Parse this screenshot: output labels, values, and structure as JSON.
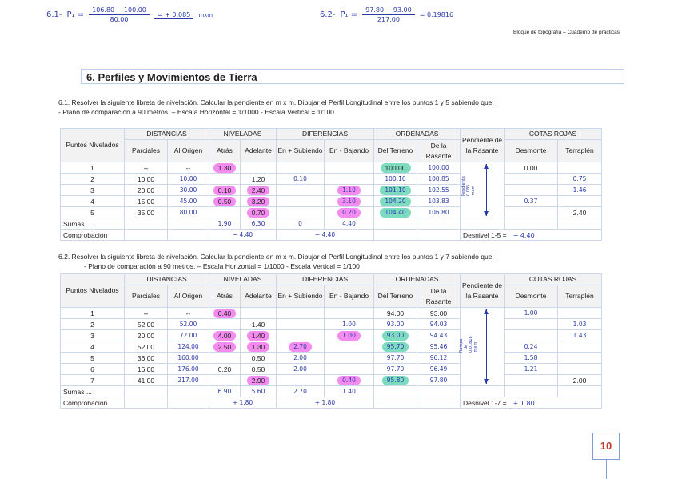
{
  "formulas": [
    {
      "label": "6.1-",
      "var": "P₁ =",
      "num": "106.80 − 100.00",
      "den": "80.00",
      "result": "= + 0.085",
      "unit": "mxm"
    },
    {
      "label": "6.2-",
      "var": "P₁ =",
      "num": "97.80 − 93.00",
      "den": "217.00",
      "result": "= 0.19816",
      "unit": ""
    }
  ],
  "header_note": "Bloque de topografía – Cuaderno de prácticas",
  "section_title": "6. Perfiles y Movimientos de Tierra",
  "headers": {
    "puntos": "Puntos Nivelados",
    "distancias": "DISTANCIAS",
    "niveladas": "NIVELADAS",
    "diferencias": "DIFERENCIAS",
    "ordenadas": "ORDENADAS",
    "pendiente": "Pendiente de la Rasante",
    "cotas": "COTAS  ROJAS",
    "sub": [
      "Parciales",
      "Al Origen",
      "Atrás",
      "Adelante",
      "En + Subiendo",
      "En - Bajando",
      "Del Terreno",
      "De la Rasante",
      "Desmonte",
      "Terraplén"
    ]
  },
  "exercises": [
    {
      "statement1": "6.1. Resolver la siguiente libreta de nivelación. Calcular la pendiente en m x m. Dibujar el Perfil Longitudinal entre los puntos 1 y 5 sabiendo que:",
      "statement2": "- Plano de comparación a 90 metros.   – Escala Horizontal = 1/1000       - Escala Vertical = 1/100",
      "pendiente_note": "Pendiente 0.085 mxm",
      "rows": [
        {
          "cells": [
            {
              "v": "1"
            },
            {
              "v": "--"
            },
            {
              "v": "--"
            },
            {
              "v": "1.30",
              "hl": "pink"
            },
            {
              "v": ""
            },
            {
              "v": ""
            },
            {
              "v": ""
            },
            {
              "v": "100.00",
              "hl": "teal"
            },
            {
              "v": "100.00",
              "h": 1
            },
            {
              "v": "0.00"
            },
            {
              "v": ""
            }
          ]
        },
        {
          "cells": [
            {
              "v": "2"
            },
            {
              "v": "10.00"
            },
            {
              "v": "10.00",
              "h": 1
            },
            {
              "v": ""
            },
            {
              "v": "1.20"
            },
            {
              "v": "0.10",
              "h": 1
            },
            {
              "v": ""
            },
            {
              "v": "100.10",
              "h": 1
            },
            {
              "v": "100.85",
              "h": 1
            },
            {
              "v": ""
            },
            {
              "v": "0.75",
              "h": 1
            }
          ]
        },
        {
          "cells": [
            {
              "v": "3"
            },
            {
              "v": "20.00"
            },
            {
              "v": "30.00",
              "h": 1
            },
            {
              "v": "0.10",
              "hl": "pink"
            },
            {
              "v": "2.40",
              "hl": "pink"
            },
            {
              "v": ""
            },
            {
              "v": "1.10",
              "h": 1,
              "hl": "pink"
            },
            {
              "v": "101.10",
              "h": 1,
              "hl": "teal"
            },
            {
              "v": "102.55",
              "h": 1
            },
            {
              "v": ""
            },
            {
              "v": "1.46",
              "h": 1
            }
          ]
        },
        {
          "cells": [
            {
              "v": "4"
            },
            {
              "v": "15.00"
            },
            {
              "v": "45.00",
              "h": 1
            },
            {
              "v": "0.50",
              "hl": "pink"
            },
            {
              "v": "3.20",
              "hl": "pink"
            },
            {
              "v": ""
            },
            {
              "v": "3.10",
              "h": 1,
              "hl": "pink"
            },
            {
              "v": "104.20",
              "h": 1,
              "hl": "teal"
            },
            {
              "v": "103.83",
              "h": 1
            },
            {
              "v": "0.37",
              "h": 1
            },
            {
              "v": ""
            }
          ]
        },
        {
          "cells": [
            {
              "v": "5"
            },
            {
              "v": "35.00"
            },
            {
              "v": "80.00",
              "h": 1
            },
            {
              "v": ""
            },
            {
              "v": "0.70",
              "hl": "pink"
            },
            {
              "v": ""
            },
            {
              "v": "0.20",
              "h": 1,
              "hl": "pink"
            },
            {
              "v": "104.40",
              "h": 1,
              "hl": "teal"
            },
            {
              "v": "106.80",
              "h": 1
            },
            {
              "v": ""
            },
            {
              "v": "2.40"
            }
          ]
        }
      ],
      "sumas": {
        "label": "Sumas ...",
        "atras": "1.90",
        "adelante": "6.30",
        "subiendo": "0",
        "bajando": "4.40"
      },
      "comprobacion": {
        "label": "Comprobación",
        "niveladas": "− 4.40",
        "diferencias": "− 4.40",
        "desnivel_label": "Desnivel 1-5 =",
        "desnivel": "− 4.40"
      }
    },
    {
      "statement1": "6.2. Resolver la siguiente libreta de nivelación. Calcular la pendiente en m x m. Dibujar el Perfil Longitudinal entre los puntos 1 y 7 sabiendo que:",
      "statement2": "- Plano de comparación a 90 metros.   – Escala Horizontal = 1/1000       - Escala Vertical = 1/100",
      "pendiente_note": "Rampa de 0.01816 mxm",
      "rows": [
        {
          "cells": [
            {
              "v": "1"
            },
            {
              "v": "--"
            },
            {
              "v": "--"
            },
            {
              "v": "0.40",
              "hl": "pink"
            },
            {
              "v": ""
            },
            {
              "v": ""
            },
            {
              "v": ""
            },
            {
              "v": "94.00"
            },
            {
              "v": "93.00"
            },
            {
              "v": "1.00",
              "h": 1
            },
            {
              "v": ""
            }
          ]
        },
        {
          "cells": [
            {
              "v": "2"
            },
            {
              "v": "52.00"
            },
            {
              "v": "52.00",
              "h": 1
            },
            {
              "v": ""
            },
            {
              "v": "1.40"
            },
            {
              "v": ""
            },
            {
              "v": "1.00",
              "h": 1
            },
            {
              "v": "93.00",
              "h": 1
            },
            {
              "v": "94.03",
              "h": 1
            },
            {
              "v": ""
            },
            {
              "v": "1.03",
              "h": 1
            }
          ]
        },
        {
          "cells": [
            {
              "v": "3"
            },
            {
              "v": "20.00"
            },
            {
              "v": "72.00",
              "h": 1
            },
            {
              "v": "4.00",
              "hl": "pink"
            },
            {
              "v": "1.40",
              "hl": "pink"
            },
            {
              "v": ""
            },
            {
              "v": "1.00",
              "h": 1,
              "hl": "pink"
            },
            {
              "v": "93.00",
              "h": 1,
              "hl": "teal"
            },
            {
              "v": "94.43",
              "h": 1
            },
            {
              "v": ""
            },
            {
              "v": "1.43",
              "h": 1
            }
          ]
        },
        {
          "cells": [
            {
              "v": "4"
            },
            {
              "v": "52.00"
            },
            {
              "v": "124.00",
              "h": 1
            },
            {
              "v": "2.50",
              "hl": "pink"
            },
            {
              "v": "1.30",
              "hl": "pink"
            },
            {
              "v": "2.70",
              "h": 1,
              "hl": "pink"
            },
            {
              "v": ""
            },
            {
              "v": "95.70",
              "h": 1,
              "hl": "teal"
            },
            {
              "v": "95.46",
              "h": 1
            },
            {
              "v": "0.24",
              "h": 1
            },
            {
              "v": ""
            }
          ]
        },
        {
          "cells": [
            {
              "v": "5"
            },
            {
              "v": "36.00"
            },
            {
              "v": "160.00",
              "h": 1
            },
            {
              "v": ""
            },
            {
              "v": "0.50"
            },
            {
              "v": "2.00",
              "h": 1
            },
            {
              "v": ""
            },
            {
              "v": "97.70",
              "h": 1
            },
            {
              "v": "96.12",
              "h": 1
            },
            {
              "v": "1.58",
              "h": 1
            },
            {
              "v": ""
            }
          ]
        },
        {
          "cells": [
            {
              "v": "6"
            },
            {
              "v": "16.00"
            },
            {
              "v": "176.00",
              "h": 1
            },
            {
              "v": "0.20"
            },
            {
              "v": "0.50"
            },
            {
              "v": "2.00",
              "h": 1
            },
            {
              "v": ""
            },
            {
              "v": "97.70",
              "h": 1
            },
            {
              "v": "96.49",
              "h": 1
            },
            {
              "v": "1.21",
              "h": 1
            },
            {
              "v": ""
            }
          ]
        },
        {
          "cells": [
            {
              "v": "7"
            },
            {
              "v": "41.00"
            },
            {
              "v": "217.00",
              "h": 1
            },
            {
              "v": ""
            },
            {
              "v": "2.90",
              "hl": "pink"
            },
            {
              "v": ""
            },
            {
              "v": "0.40",
              "h": 1,
              "hl": "pink"
            },
            {
              "v": "95.80",
              "h": 1,
              "hl": "teal"
            },
            {
              "v": "97.80",
              "h": 1
            },
            {
              "v": ""
            },
            {
              "v": "2.00"
            }
          ]
        }
      ],
      "sumas": {
        "label": "Sumas ...",
        "atras": "6.90",
        "adelante": "5.60",
        "subiendo": "2.70",
        "bajando": "1.40"
      },
      "comprobacion": {
        "label": "Comprobación",
        "niveladas": "+ 1.80",
        "diferencias": "+ 1.80",
        "desnivel_label": "Desnivel 1-7 =",
        "desnivel": "+ 1.80"
      }
    }
  ],
  "page_number": "10",
  "colors": {
    "pink": "#f48cf0",
    "teal": "#7ddbc0",
    "ink": "#2a3aa8",
    "page_number": "#c0392b"
  }
}
